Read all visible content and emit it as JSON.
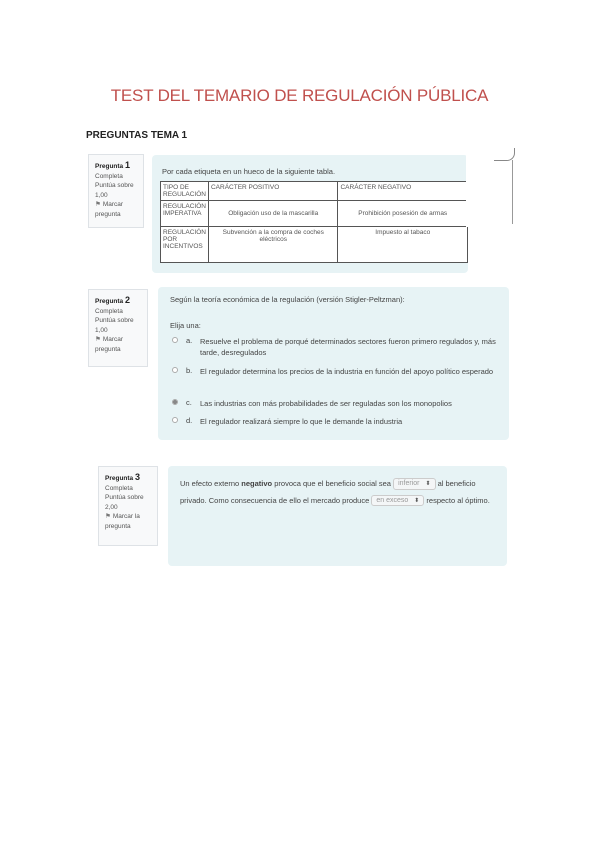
{
  "document_title": "TEST DEL TEMARIO DE REGULACIÓN PÚBLICA",
  "section_heading": "PREGUNTAS TEMA 1",
  "questions": [
    {
      "label": "Pregunta",
      "number": "1",
      "status": "Completa",
      "score": "Puntúa sobre 1,00",
      "flag_label": "Marcar pregunta",
      "prompt": "Por cada etiqueta en un hueco de la siguiente tabla.",
      "table": {
        "headers": [
          "TIPO DE REGULACIÓN",
          "CARÁCTER POSITIVO",
          "CARÁCTER NEGATIVO"
        ],
        "rows": [
          [
            "REGULACIÓN IMPERATIVA",
            "Obligación uso de la mascarilla",
            "Prohibición posesión de armas"
          ],
          [
            "REGULACIÓN POR INCENTIVOS",
            "Subvención a la compra de coches eléctricos",
            "Impuesto al tabaco"
          ]
        ]
      }
    },
    {
      "label": "Pregunta",
      "number": "2",
      "status": "Completa",
      "score": "Puntúa sobre 1,00",
      "flag_label": "Marcar pregunta",
      "prompt": "Según la teoría económica de la regulación (versión Stigler-Peltzman):",
      "instruction": "Elija una:",
      "options": [
        {
          "letter": "a.",
          "text": "Resuelve el problema de porqué determinados sectores fueron primero regulados y, más tarde, desregulados",
          "selected": false
        },
        {
          "letter": "b.",
          "text": "El regulador determina los precios de la industria en función del apoyo político esperado",
          "selected": false
        },
        {
          "letter": "c.",
          "text": "Las industrias con más probabilidades de ser reguladas son los monopolios",
          "selected": true
        },
        {
          "letter": "d.",
          "text": "El regulador realizará siempre lo que le demande la industria",
          "selected": false
        }
      ]
    },
    {
      "label": "Pregunta",
      "number": "3",
      "status": "Completa",
      "score": "Puntúa sobre 2,00",
      "flag_label": "Marcar la pregunta",
      "text_1": "Un efecto externo ",
      "text_bold": "negativo",
      "text_2": " provoca que el beneficio social sea ",
      "select_1": "inferior",
      "text_3": " al beneficio privado. Como consecuencia de ello el mercado produce ",
      "select_2": "en exceso",
      "text_4": " respecto al óptimo."
    }
  ]
}
